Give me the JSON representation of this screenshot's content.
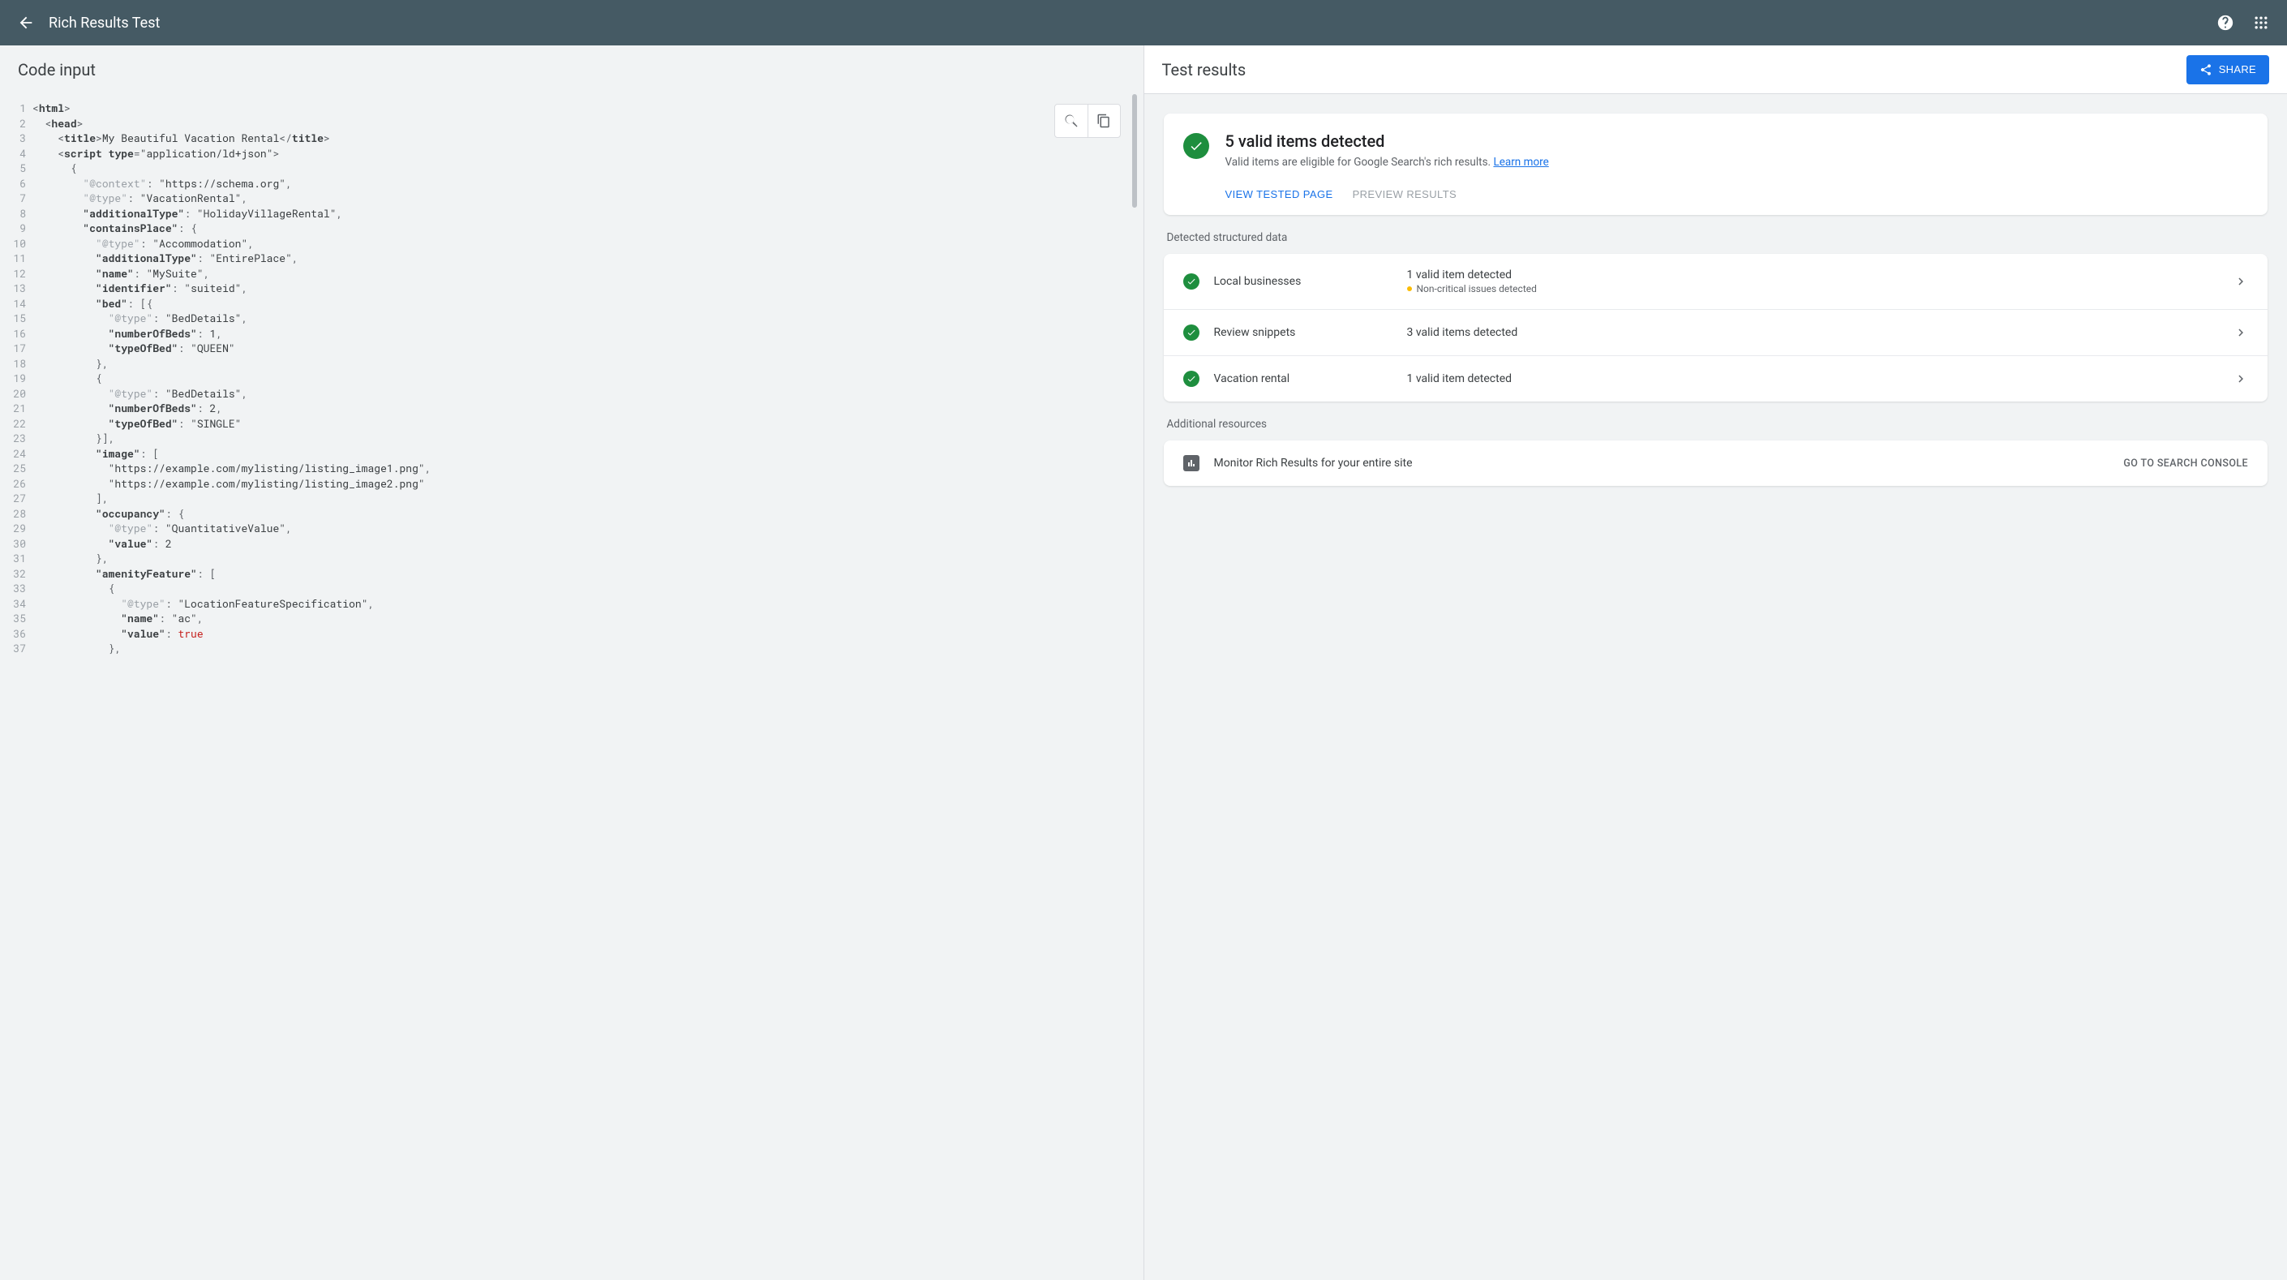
{
  "header": {
    "title": "Rich Results Test"
  },
  "left": {
    "title": "Code input",
    "code_lines": [
      {
        "n": 1,
        "html": "<span class='tok-punc'>&lt;</span><span class='tok-tag'>html</span><span class='tok-punc'>&gt;</span>"
      },
      {
        "n": 2,
        "html": "  <span class='tok-punc'>&lt;</span><span class='tok-tag'>head</span><span class='tok-punc'>&gt;</span>"
      },
      {
        "n": 3,
        "html": "    <span class='tok-punc'>&lt;</span><span class='tok-tag'>title</span><span class='tok-punc'>&gt;</span>My Beautiful Vacation Rental<span class='tok-punc'>&lt;/</span><span class='tok-tag'>title</span><span class='tok-punc'>&gt;</span>"
      },
      {
        "n": 4,
        "html": "    <span class='tok-punc'>&lt;</span><span class='tok-tag'>script</span> <span class='tok-attr'>type</span><span class='tok-punc'>=</span><span class='tok-str'>\"application/ld+json\"</span><span class='tok-punc'>&gt;</span>"
      },
      {
        "n": 5,
        "html": "      <span class='tok-punc'>{</span>"
      },
      {
        "n": 6,
        "html": "        <span class='tok-keydim'>\"@context\"</span><span class='tok-punc'>:</span> <span class='tok-str'>\"https://schema.org\"</span><span class='tok-punc'>,</span>"
      },
      {
        "n": 7,
        "html": "        <span class='tok-keydim'>\"@type\"</span><span class='tok-punc'>:</span> <span class='tok-str'>\"VacationRental\"</span><span class='tok-punc'>,</span>"
      },
      {
        "n": 8,
        "html": "        <span class='tok-key'>\"additionalType\"</span><span class='tok-punc'>:</span> <span class='tok-str'>\"HolidayVillageRental\"</span><span class='tok-punc'>,</span>"
      },
      {
        "n": 9,
        "html": "        <span class='tok-key'>\"containsPlace\"</span><span class='tok-punc'>:</span> <span class='tok-punc'>{</span>"
      },
      {
        "n": 10,
        "html": "          <span class='tok-keydim'>\"@type\"</span><span class='tok-punc'>:</span> <span class='tok-str'>\"Accommodation\"</span><span class='tok-punc'>,</span>"
      },
      {
        "n": 11,
        "html": "          <span class='tok-key'>\"additionalType\"</span><span class='tok-punc'>:</span> <span class='tok-str'>\"EntirePlace\"</span><span class='tok-punc'>,</span>"
      },
      {
        "n": 12,
        "html": "          <span class='tok-key'>\"name\"</span><span class='tok-punc'>:</span> <span class='tok-str'>\"MySuite\"</span><span class='tok-punc'>,</span>"
      },
      {
        "n": 13,
        "html": "          <span class='tok-key'>\"identifier\"</span><span class='tok-punc'>:</span> <span class='tok-str'>\"suiteid\"</span><span class='tok-punc'>,</span>"
      },
      {
        "n": 14,
        "html": "          <span class='tok-key'>\"bed\"</span><span class='tok-punc'>:</span> <span class='tok-punc'>[{</span>"
      },
      {
        "n": 15,
        "html": "            <span class='tok-keydim'>\"@type\"</span><span class='tok-punc'>:</span> <span class='tok-str'>\"BedDetails\"</span><span class='tok-punc'>,</span>"
      },
      {
        "n": 16,
        "html": "            <span class='tok-key'>\"numberOfBeds\"</span><span class='tok-punc'>:</span> 1<span class='tok-punc'>,</span>"
      },
      {
        "n": 17,
        "html": "            <span class='tok-key'>\"typeOfBed\"</span><span class='tok-punc'>:</span> <span class='tok-str'>\"QUEEN\"</span>"
      },
      {
        "n": 18,
        "html": "          <span class='tok-punc'>},</span>"
      },
      {
        "n": 19,
        "html": "          <span class='tok-punc'>{</span>"
      },
      {
        "n": 20,
        "html": "            <span class='tok-keydim'>\"@type\"</span><span class='tok-punc'>:</span> <span class='tok-str'>\"BedDetails\"</span><span class='tok-punc'>,</span>"
      },
      {
        "n": 21,
        "html": "            <span class='tok-key'>\"numberOfBeds\"</span><span class='tok-punc'>:</span> 2<span class='tok-punc'>,</span>"
      },
      {
        "n": 22,
        "html": "            <span class='tok-key'>\"typeOfBed\"</span><span class='tok-punc'>:</span> <span class='tok-str'>\"SINGLE\"</span>"
      },
      {
        "n": 23,
        "html": "          <span class='tok-punc'>}],</span>"
      },
      {
        "n": 24,
        "html": "          <span class='tok-key'>\"image\"</span><span class='tok-punc'>:</span> <span class='tok-punc'>[</span>"
      },
      {
        "n": 25,
        "html": "            <span class='tok-str'>\"https://example.com/mylisting/listing_image1.png\"</span><span class='tok-punc'>,</span>"
      },
      {
        "n": 26,
        "html": "            <span class='tok-str'>\"https://example.com/mylisting/listing_image2.png\"</span>"
      },
      {
        "n": 27,
        "html": "          <span class='tok-punc'>],</span>"
      },
      {
        "n": 28,
        "html": "          <span class='tok-key'>\"occupancy\"</span><span class='tok-punc'>:</span> <span class='tok-punc'>{</span>"
      },
      {
        "n": 29,
        "html": "            <span class='tok-keydim'>\"@type\"</span><span class='tok-punc'>:</span> <span class='tok-str'>\"QuantitativeValue\"</span><span class='tok-punc'>,</span>"
      },
      {
        "n": 30,
        "html": "            <span class='tok-key'>\"value\"</span><span class='tok-punc'>:</span> 2"
      },
      {
        "n": 31,
        "html": "          <span class='tok-punc'>},</span>"
      },
      {
        "n": 32,
        "html": "          <span class='tok-key'>\"amenityFeature\"</span><span class='tok-punc'>:</span> <span class='tok-punc'>[</span>"
      },
      {
        "n": 33,
        "html": "            <span class='tok-punc'>{</span>"
      },
      {
        "n": 34,
        "html": "              <span class='tok-keydim'>\"@type\"</span><span class='tok-punc'>:</span> <span class='tok-str'>\"LocationFeatureSpecification\"</span><span class='tok-punc'>,</span>"
      },
      {
        "n": 35,
        "html": "              <span class='tok-key'>\"name\"</span><span class='tok-punc'>:</span> <span class='tok-str'>\"ac\"</span><span class='tok-punc'>,</span>"
      },
      {
        "n": 36,
        "html": "              <span class='tok-key'>\"value\"</span><span class='tok-punc'>:</span> <span class='tok-bool'>true</span>"
      },
      {
        "n": 37,
        "html": "            <span class='tok-punc'>},</span>"
      }
    ]
  },
  "right": {
    "title": "Test results",
    "share": "SHARE",
    "summary_title": "5 valid items detected",
    "summary_sub": "Valid items are eligible for Google Search's rich results. ",
    "summary_link": "Learn more",
    "view_tested": "VIEW TESTED PAGE",
    "preview_results": "PREVIEW RESULTS",
    "detected_label": "Detected structured data",
    "items": [
      {
        "name": "Local businesses",
        "status": "1 valid item detected",
        "note": "Non-critical issues detected"
      },
      {
        "name": "Review snippets",
        "status": "3 valid items detected",
        "note": ""
      },
      {
        "name": "Vacation rental",
        "status": "1 valid item detected",
        "note": ""
      }
    ],
    "additional_label": "Additional resources",
    "monitor_text": "Monitor Rich Results for your entire site",
    "monitor_cta": "GO TO SEARCH CONSOLE"
  }
}
